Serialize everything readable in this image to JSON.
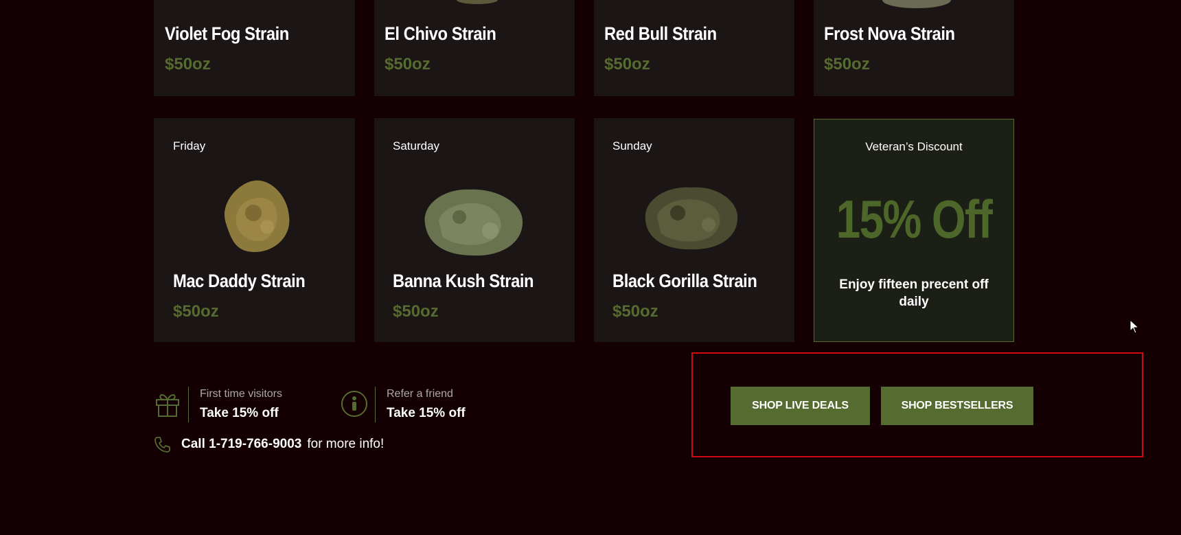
{
  "top_row": [
    {
      "name": "Violet Fog Strain",
      "price": "$50oz"
    },
    {
      "name": "El Chivo Strain",
      "price": "$50oz"
    },
    {
      "name": "Red Bull Strain",
      "price": "$50oz"
    },
    {
      "name": "Frost Nova Strain",
      "price": "$50oz"
    }
  ],
  "bottom_row": [
    {
      "day": "Friday",
      "name": "Mac Daddy Strain",
      "price": "$50oz"
    },
    {
      "day": "Saturday",
      "name": "Banna Kush Strain",
      "price": "$50oz"
    },
    {
      "day": "Sunday",
      "name": "Black Gorilla Strain",
      "price": "$50oz"
    }
  ],
  "veteran": {
    "title": "Veteran’s Discount",
    "discount": "15% Off",
    "text": "Enjoy fifteen precent off daily"
  },
  "promos": [
    {
      "icon": "gift-icon",
      "label": "First time visitors",
      "value": "Take 15% off"
    },
    {
      "icon": "person-icon",
      "label": "Refer a friend",
      "value": "Take 15% off"
    }
  ],
  "call": {
    "icon": "phone-icon",
    "strong": "Call 1-719-766-9003",
    "rest": "for more info!"
  },
  "buttons": {
    "live_deals": "SHOP LIVE DEALS",
    "bestsellers": "SHOP BESTSELLERS"
  },
  "colors": {
    "background": "#140003",
    "card": "#1c1515",
    "accent": "#556b2f",
    "highlight": "#d00a14"
  }
}
